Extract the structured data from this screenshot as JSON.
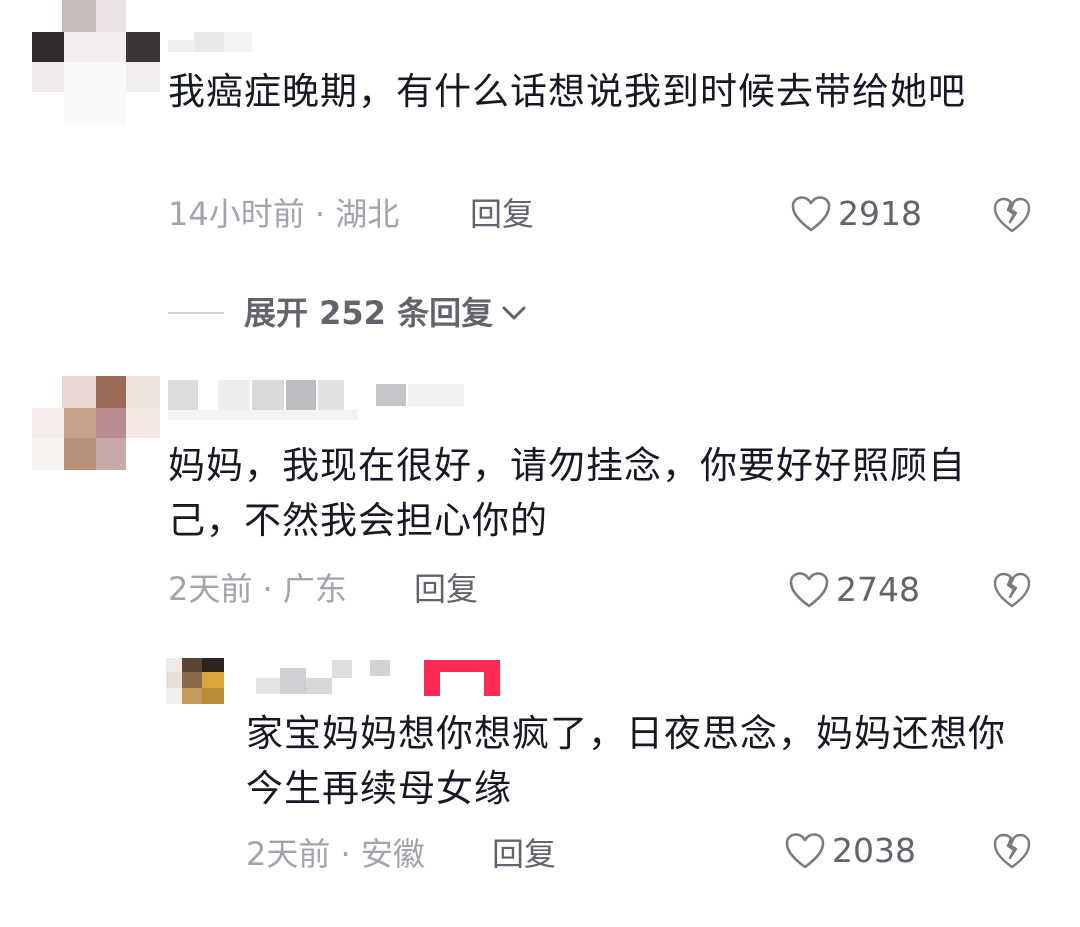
{
  "comments": [
    {
      "text": "我癌症晚期，有什么话想说我到时候去带给她吧",
      "time_location": "14小时前 · 湖北",
      "reply_label": "回复",
      "likes": "2918",
      "expand_label": "展开 252 条回复"
    },
    {
      "text": "妈妈，我现在很好，请勿挂念，你要好好照顾自己，不然我会担心你的",
      "time_location": "2天前 · 广东",
      "reply_label": "回复",
      "likes": "2748"
    }
  ],
  "reply": {
    "text": "家宝妈妈想你想疯了，日夜思念，妈妈还想你今生再续母女缘",
    "time_location": "2天前 · 安徽",
    "reply_label": "回复",
    "likes": "2038"
  },
  "colors": {
    "text": "#161823",
    "meta": "#a3a4ab",
    "action": "#62636b",
    "badge": "#fe2c55"
  },
  "icons": [
    "heart-outline-icon",
    "broken-heart-icon",
    "chevron-down-icon"
  ]
}
